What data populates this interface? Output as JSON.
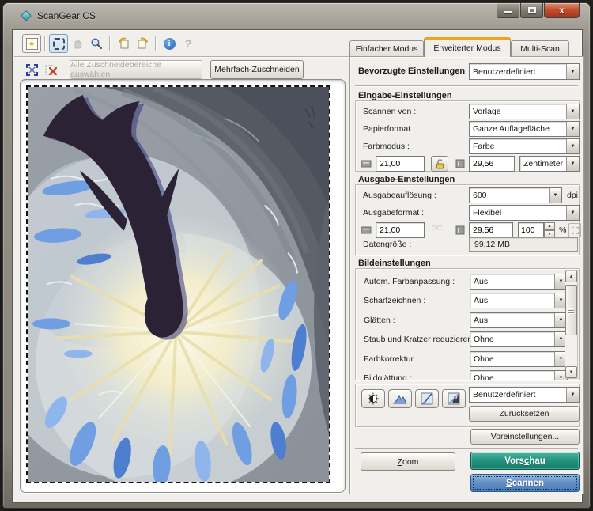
{
  "window": {
    "title": "ScanGear CS"
  },
  "toolbar": {
    "icons": {
      "thumbnail": "star-thumbnail",
      "crop": "crop-marquee",
      "move": "hand",
      "zoom": "magnifier",
      "rotate_left": "rotate-left",
      "rotate_right": "rotate-right",
      "info": "i",
      "help": "?"
    }
  },
  "crop_bar": {
    "select_all": "Alle Zuschneidebereiche auswählen",
    "multi_crop": "Mehrfach-Zuschneiden"
  },
  "tabs": {
    "simple": "Einfacher Modus",
    "advanced": "Erweiterter Modus",
    "multi": "Multi-Scan"
  },
  "favorites": {
    "label": "Bevorzugte Einstellungen",
    "value": "Benutzerdefiniert"
  },
  "input_settings": {
    "title": "Eingabe-Einstellungen",
    "rows": [
      {
        "label": "Scannen von :",
        "value": "Vorlage"
      },
      {
        "label": "Papierformat :",
        "value": "Ganze Auflagefläche"
      },
      {
        "label": "Farbmodus :",
        "value": "Farbe"
      }
    ],
    "width": "21,00",
    "height": "29,56",
    "unit": "Zentimeter"
  },
  "output_settings": {
    "title": "Ausgabe-Einstellungen",
    "resolution_label": "Ausgabeauflösung :",
    "resolution_value": "600",
    "resolution_unit": "dpi",
    "format_label": "Ausgabeformat :",
    "format_value": "Flexibel",
    "width": "21,00",
    "height": "29,56",
    "scale": "100",
    "scale_unit": "%",
    "datasize_label": "Datengröße :",
    "datasize_value": "99,12 MB"
  },
  "image_settings": {
    "title": "Bildeinstellungen",
    "rows": [
      {
        "label": "Autom. Farbanpassung :",
        "value": "Aus"
      },
      {
        "label": "Scharfzeichnen :",
        "value": "Aus"
      },
      {
        "label": "Glätten :",
        "value": "Aus"
      },
      {
        "label": "Staub und Kratzer reduzieren :",
        "value": "Ohne"
      },
      {
        "label": "Farbkorrektur :",
        "value": "Ohne"
      },
      {
        "label": "Bildglättung :",
        "value": "Ohne"
      }
    ]
  },
  "tone": {
    "preset": "Benutzerdefiniert",
    "reset": "Zurücksetzen"
  },
  "actions": {
    "preferences": "Voreinstellungen...",
    "zoom": {
      "label": "Zoom",
      "accel": 0
    },
    "preview": {
      "label": "Vorschau",
      "accel": 4
    },
    "scan": {
      "label": "Scannen",
      "accel": 0
    }
  },
  "preview": {
    "description": "Watercolor painting: dark silhouette of a figure with a whale tail diving head-first toward a glowing light with radiating rays, surrounded by gray and blue water swirls"
  },
  "colors": {
    "tab_accent": "#f0a41d",
    "preview_button": "#239580",
    "scan_button": "#6490c4",
    "ripple_blue": "#6f9ee2"
  }
}
